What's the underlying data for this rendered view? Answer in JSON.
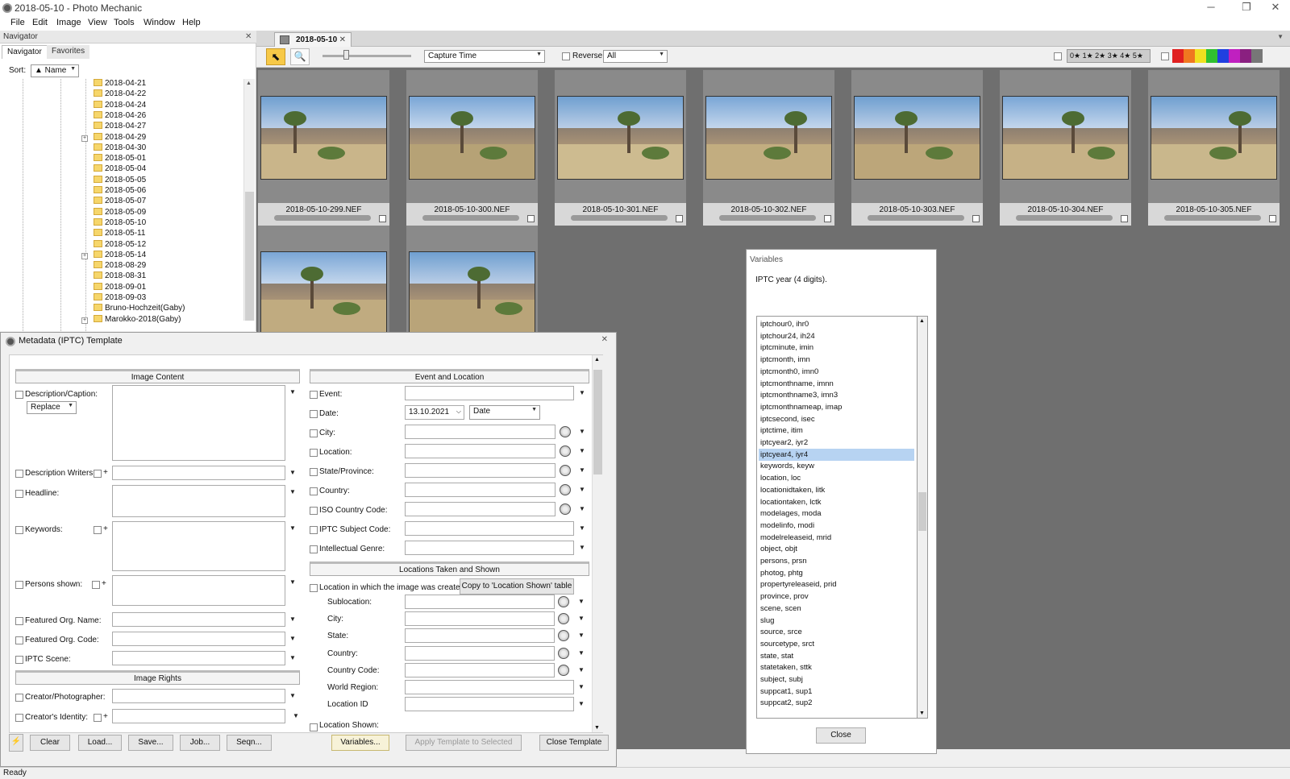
{
  "window": {
    "title": "2018-05-10 - Photo Mechanic"
  },
  "menu": [
    "File",
    "Edit",
    "Image",
    "View",
    "Tools",
    "Window",
    "Help"
  ],
  "navigator": {
    "header": "Navigator",
    "tabs": [
      "Navigator",
      "Favorites"
    ],
    "sort_label": "Sort:",
    "sort_value": "▲ Name",
    "folders": [
      "2018-04-21",
      "2018-04-22",
      "2018-04-24",
      "2018-04-26",
      "2018-04-27",
      "2018-04-29",
      "2018-04-30",
      "2018-05-01",
      "2018-05-04",
      "2018-05-05",
      "2018-05-06",
      "2018-05-07",
      "2018-05-09",
      "2018-05-10",
      "2018-05-11",
      "2018-05-12",
      "2018-05-14",
      "2018-08-29",
      "2018-08-31",
      "2018-09-01",
      "2018-09-03",
      "Bruno-Hochzeit(Gaby)",
      "Marokko-2018(Gaby)"
    ]
  },
  "contact_sheet": {
    "tab": "2018-05-10",
    "sort_field": "Capture Time",
    "reverse_label": "Reverse",
    "filter": "All",
    "star_filter": "0★ 1★ 2★ 3★ 4★ 5★",
    "color_labels": [
      "#e02020",
      "#f07820",
      "#f0e020",
      "#30c030",
      "#2040e0",
      "#c020c0",
      "#8a2080",
      "#777777"
    ],
    "photos": [
      "2018-05-10-299.NEF",
      "2018-05-10-300.NEF",
      "2018-05-10-301.NEF",
      "2018-05-10-302.NEF",
      "2018-05-10-303.NEF",
      "2018-05-10-304.NEF",
      "2018-05-10-305.NEF"
    ]
  },
  "variables": {
    "title": "Variables",
    "description": "IPTC year (4 digits).",
    "items": [
      "iptchour0, ihr0",
      "iptchour24, ih24",
      "iptcminute, imin",
      "iptcmonth, imn",
      "iptcmonth0, imn0",
      "iptcmonthname, imnn",
      "iptcmonthname3, imn3",
      "iptcmonthnameap, imap",
      "iptcsecond, isec",
      "iptctime, itim",
      "iptcyear2, iyr2",
      "iptcyear4, iyr4",
      "keywords, keyw",
      "location, loc",
      "locationidtaken, litk",
      "locationtaken, lctk",
      "modelages, moda",
      "modelinfo, modi",
      "modelreleaseid, mrid",
      "object, objt",
      "persons, prsn",
      "photog, phtg",
      "propertyreleaseid, prid",
      "province, prov",
      "scene, scen",
      "slug",
      "source, srce",
      "sourcetype, srct",
      "state, stat",
      "statetaken, sttk",
      "subject, subj",
      "suppcat1, sup1",
      "suppcat2, sup2"
    ],
    "selected": "iptcyear4, iyr4",
    "close": "Close"
  },
  "metadata": {
    "title": "Metadata (IPTC) Template",
    "sections": {
      "image_content": "Image Content",
      "event_location": "Event and Location",
      "locations_taken": "Locations Taken and Shown",
      "image_rights": "Image Rights"
    },
    "left_fields": {
      "description": "Description/Caption:",
      "replace": "Replace",
      "writers": "Description Writers:",
      "headline": "Headline:",
      "keywords": "Keywords:",
      "persons": "Persons shown:",
      "org_name": "Featured Org. Name:",
      "org_code": "Featured Org. Code:",
      "scene": "IPTC Scene:",
      "creator": "Creator/Photographer:",
      "identity": "Creator's Identity:"
    },
    "right_fields": {
      "event": "Event:",
      "date": "Date:",
      "date_value": "13.10.2021",
      "date_mode": "Date",
      "city": "City:",
      "location": "Location:",
      "state": "State/Province:",
      "country": "Country:",
      "iso": "ISO Country Code:",
      "subject": "IPTC Subject Code:",
      "genre": "Intellectual Genre:"
    },
    "loc_created": "Location in which the image was created:",
    "copy_btn": "Copy to 'Location Shown' table",
    "loc_fields": [
      "Sublocation:",
      "City:",
      "State:",
      "Country:",
      "Country Code:",
      "World Region:",
      "Location ID"
    ],
    "loc_shown": "Location Shown:",
    "buttons": {
      "clear": "Clear",
      "load": "Load...",
      "save": "Save...",
      "job": "Job...",
      "seqn": "Seqn...",
      "variables": "Variables...",
      "apply": "Apply Template to Selected",
      "close": "Close Template"
    }
  },
  "status": "Ready"
}
